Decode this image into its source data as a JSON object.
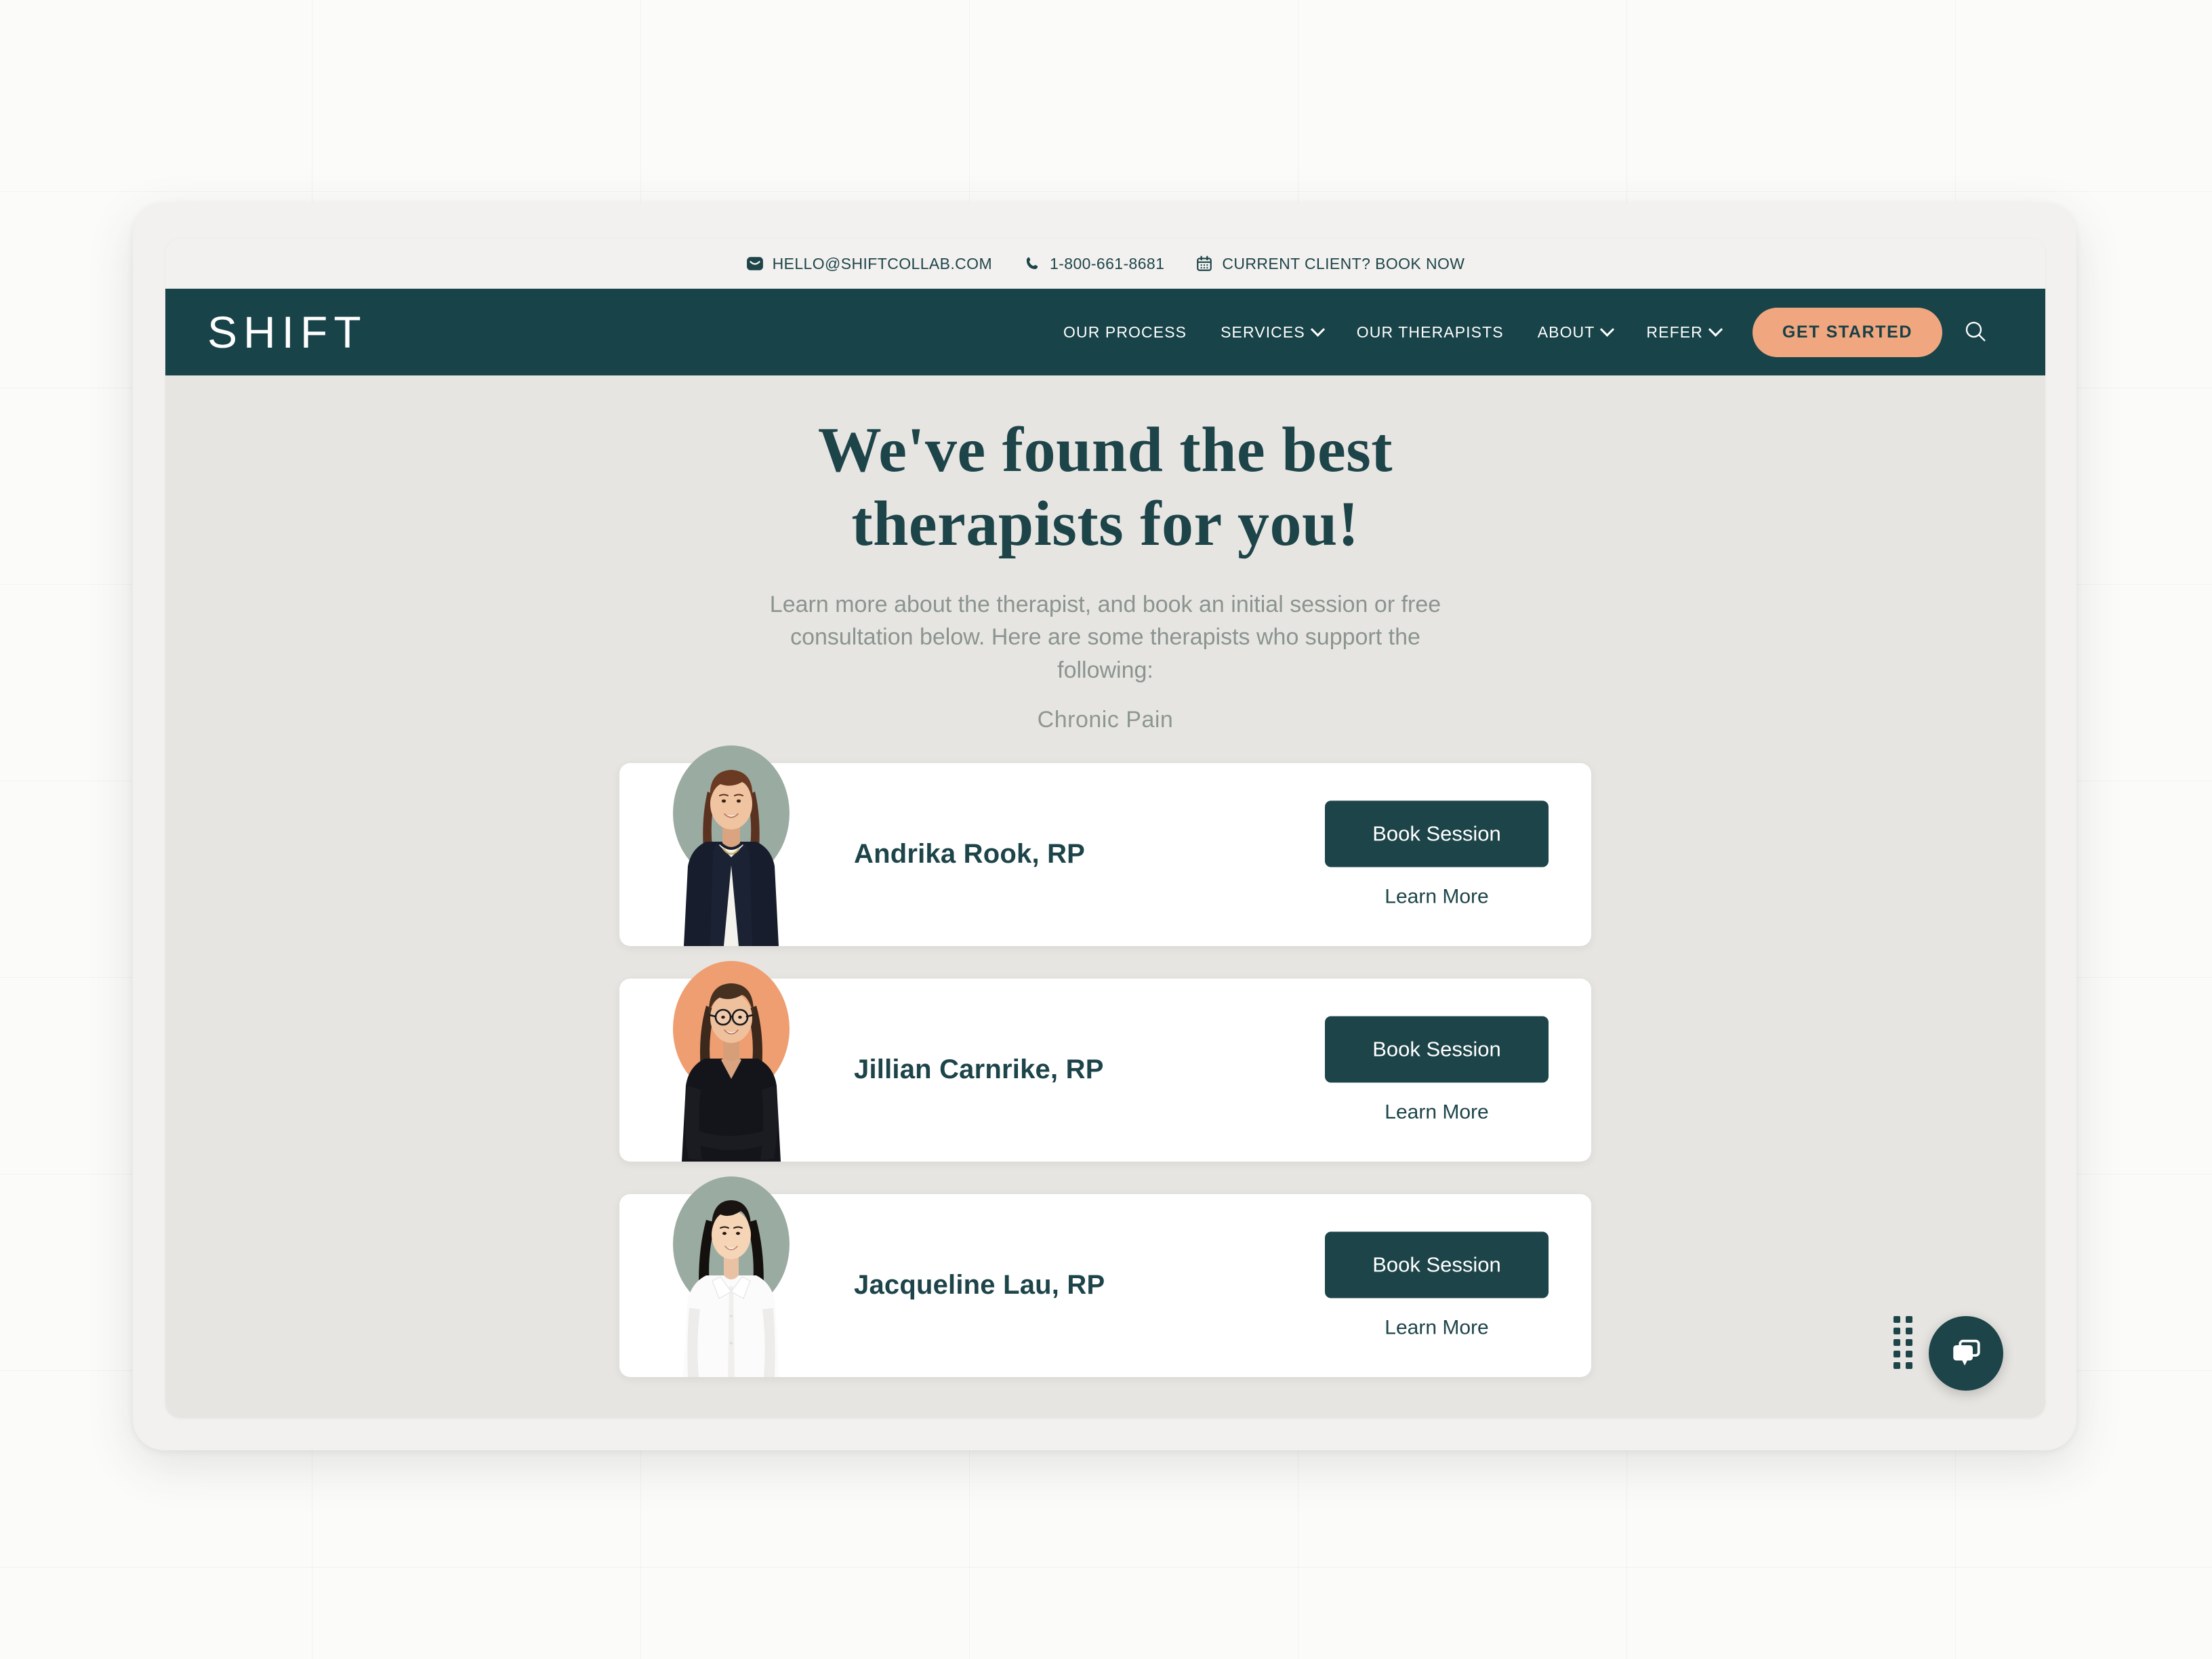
{
  "colors": {
    "nav_teal": "#184349",
    "accent_peach": "#f0a77f",
    "page_bg": "#e7e5e1",
    "card_bg": "#ffffff",
    "muted_text": "#8a9490",
    "blob_sage": "#9aaba2",
    "blob_peach": "#ef9e71"
  },
  "utility_bar": {
    "items": [
      {
        "icon": "envelope-icon",
        "label": "HELLO@SHIFTCOLLAB.COM"
      },
      {
        "icon": "phone-icon",
        "label": "1-800-661-8681"
      },
      {
        "icon": "calendar-icon",
        "label": "CURRENT CLIENT? BOOK NOW"
      }
    ]
  },
  "nav": {
    "brand": "SHIFT",
    "links": [
      {
        "label": "OUR PROCESS",
        "has_dropdown": false
      },
      {
        "label": "SERVICES",
        "has_dropdown": true
      },
      {
        "label": "OUR THERAPISTS",
        "has_dropdown": false
      },
      {
        "label": "ABOUT",
        "has_dropdown": true
      },
      {
        "label": "REFER",
        "has_dropdown": true
      }
    ],
    "cta_label": "GET STARTED",
    "search_icon": "search-icon"
  },
  "hero": {
    "title_line1": "We've found the best",
    "title_line2": "therapists for you!",
    "subtitle": "Learn more about the therapist, and book an initial session or free consultation below. Here are some therapists who support the following:",
    "tag": "Chronic Pain"
  },
  "cards": {
    "book_label": "Book Session",
    "learn_label": "Learn More",
    "items": [
      {
        "name": "Andrika Rook, RP",
        "blob_color": "#9aaba2",
        "photo": "therapist-photo-andrika"
      },
      {
        "name": "Jillian Carnrike, RP",
        "blob_color": "#ef9e71",
        "photo": "therapist-photo-jillian"
      },
      {
        "name": "Jacqueline Lau, RP",
        "blob_color": "#9aaba2",
        "photo": "therapist-photo-jacqueline"
      }
    ]
  },
  "chat": {
    "icon": "chat-bubble-icon",
    "drag_handle": "drag-handle-dots"
  }
}
